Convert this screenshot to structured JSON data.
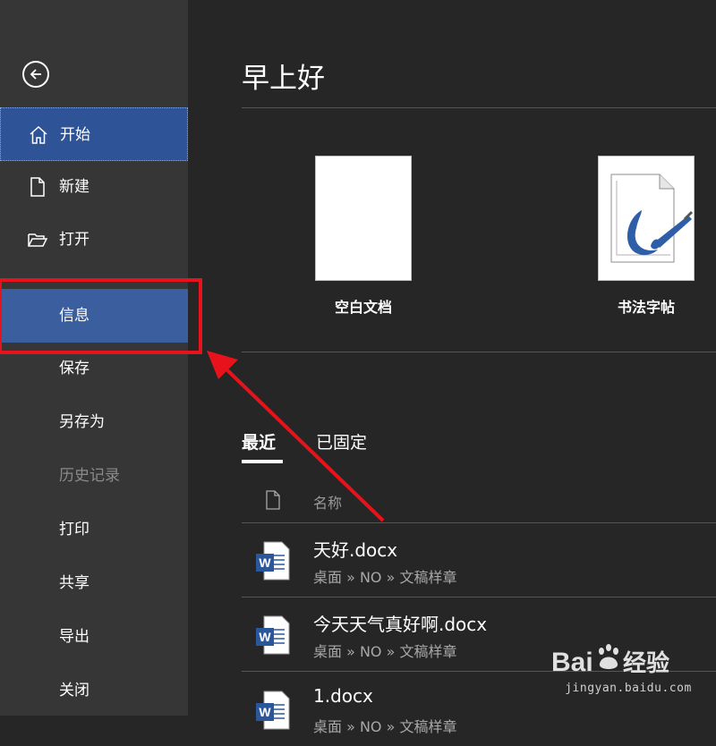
{
  "sidebar": {
    "items": [
      {
        "label": "开始",
        "icon": "home-icon"
      },
      {
        "label": "新建",
        "icon": "new-document-icon"
      },
      {
        "label": "打开",
        "icon": "open-folder-icon"
      },
      {
        "label": "信息"
      },
      {
        "label": "保存"
      },
      {
        "label": "另存为"
      },
      {
        "label": "历史记录"
      },
      {
        "label": "打印"
      },
      {
        "label": "共享"
      },
      {
        "label": "导出"
      },
      {
        "label": "关闭"
      }
    ]
  },
  "main": {
    "greeting": "早上好",
    "templates": [
      {
        "label": "空白文档"
      },
      {
        "label": "书法字帖"
      }
    ],
    "tabs": [
      {
        "label": "最近"
      },
      {
        "label": "已固定"
      }
    ],
    "list_header": {
      "name": "名称"
    },
    "files": [
      {
        "name": "天好.docx",
        "path": "桌面 » NO » 文稿样章"
      },
      {
        "name": "今天天气真好啊.docx",
        "path": "桌面 » NO » 文稿样章"
      },
      {
        "name": "1.docx",
        "path": "桌面 » NO » 文稿样章"
      }
    ]
  },
  "watermark": {
    "brand": "Baidu经验",
    "url": "jingyan.baidu.com"
  },
  "colors": {
    "sidebar_bg": "#363636",
    "main_bg": "#262626",
    "accent_blue": "#2e5396",
    "highlight_red": "#e8131a",
    "word_blue": "#2b579a"
  }
}
